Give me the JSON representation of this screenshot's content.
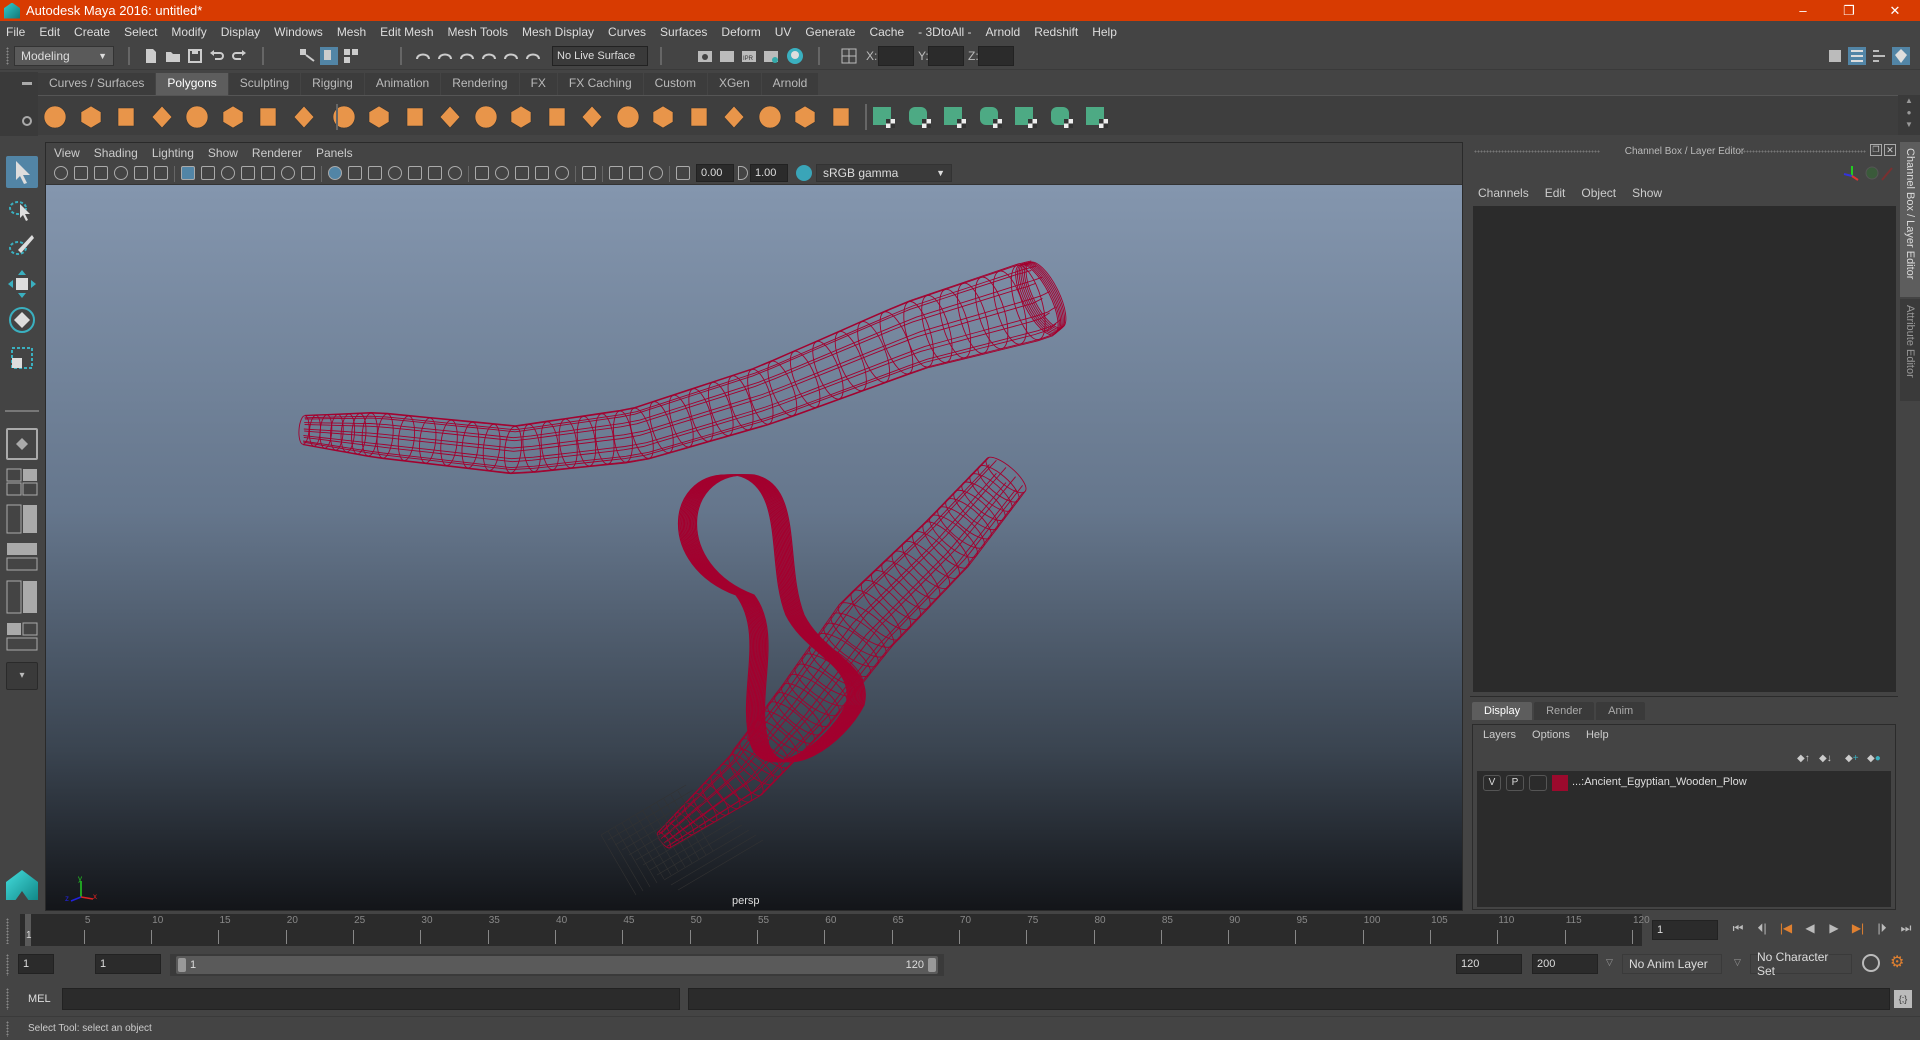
{
  "window": {
    "title": "Autodesk Maya 2016: untitled*",
    "controls": {
      "minimize": "–",
      "restore": "❐",
      "close": "✕"
    }
  },
  "menubar": [
    "File",
    "Edit",
    "Create",
    "Select",
    "Modify",
    "Display",
    "Windows",
    "Mesh",
    "Edit Mesh",
    "Mesh Tools",
    "Mesh Display",
    "Curves",
    "Surfaces",
    "Deform",
    "UV",
    "Generate",
    "Cache",
    "- 3DtoAll -",
    "Arnold",
    "Redshift",
    "Help"
  ],
  "statusline": {
    "menuset": "Modeling",
    "live_surface": "No Live Surface",
    "x_label": "X:",
    "y_label": "Y:",
    "z_label": "Z:",
    "x_value": "",
    "y_value": "",
    "z_value": ""
  },
  "shelf": {
    "tabs": [
      "Curves / Surfaces",
      "Polygons",
      "Sculpting",
      "Rigging",
      "Animation",
      "Rendering",
      "FX",
      "FX Caching",
      "Custom",
      "XGen",
      "Arnold"
    ],
    "active_tab": "Polygons",
    "orange_icons": [
      "poly-sphere",
      "poly-cube",
      "poly-cylinder",
      "poly-cone",
      "poly-plane",
      "poly-torus",
      "poly-pyramid",
      "poly-pipe",
      "combine",
      "separate",
      "mirror",
      "smooth",
      "bevel",
      "extrude",
      "bridge",
      "append-to-polygon",
      "multi-cut",
      "quad-draw",
      "target-weld",
      "connect",
      "fill-hole",
      "boolean",
      "bevel-edge"
    ],
    "green_icons": [
      "planar-uv",
      "cylindrical-uv",
      "spherical-uv",
      "automatic-uv",
      "unfold-uv",
      "uv-editor",
      "cut-sew-uv"
    ]
  },
  "viewport": {
    "menu": [
      "View",
      "Shading",
      "Lighting",
      "Show",
      "Renderer",
      "Panels"
    ],
    "exposure": "0.00",
    "gamma": "1.00",
    "color_space": "sRGB gamma",
    "camera_label": "persp",
    "axis": {
      "x": "x",
      "y": "y",
      "z": "z"
    },
    "wire_color": "#a3002e"
  },
  "channelbox": {
    "title": "Channel Box / Layer Editor",
    "menu": [
      "Channels",
      "Edit",
      "Object",
      "Show"
    ]
  },
  "layer_editor": {
    "tabs": [
      "Display",
      "Render",
      "Anim"
    ],
    "active_tab": "Display",
    "menu": [
      "Layers",
      "Options",
      "Help"
    ],
    "layers": [
      {
        "visible": "V",
        "playback": "P",
        "type": "",
        "color": "#9b0a2d",
        "name": "...:Ancient_Egyptian_Wooden_Plow"
      }
    ]
  },
  "side_tabs": [
    "Channel Box / Layer Editor",
    "Attribute Editor"
  ],
  "timeline": {
    "current_frame_marker": "1",
    "ticks": [
      "5",
      "10",
      "15",
      "20",
      "25",
      "30",
      "35",
      "40",
      "45",
      "50",
      "55",
      "60",
      "65",
      "70",
      "75",
      "80",
      "85",
      "90",
      "95",
      "100",
      "105",
      "110",
      "115",
      "120"
    ],
    "current_frame": "1"
  },
  "range": {
    "start_time": "1",
    "playback_start": "1",
    "slider_start": "1",
    "slider_end": "120",
    "playback_end": "120",
    "end_time": "200",
    "anim_layer": "No Anim Layer",
    "character_set": "No Character Set"
  },
  "mel": {
    "label": "MEL",
    "input": "",
    "result": ""
  },
  "helpline": "Select Tool: select an object"
}
